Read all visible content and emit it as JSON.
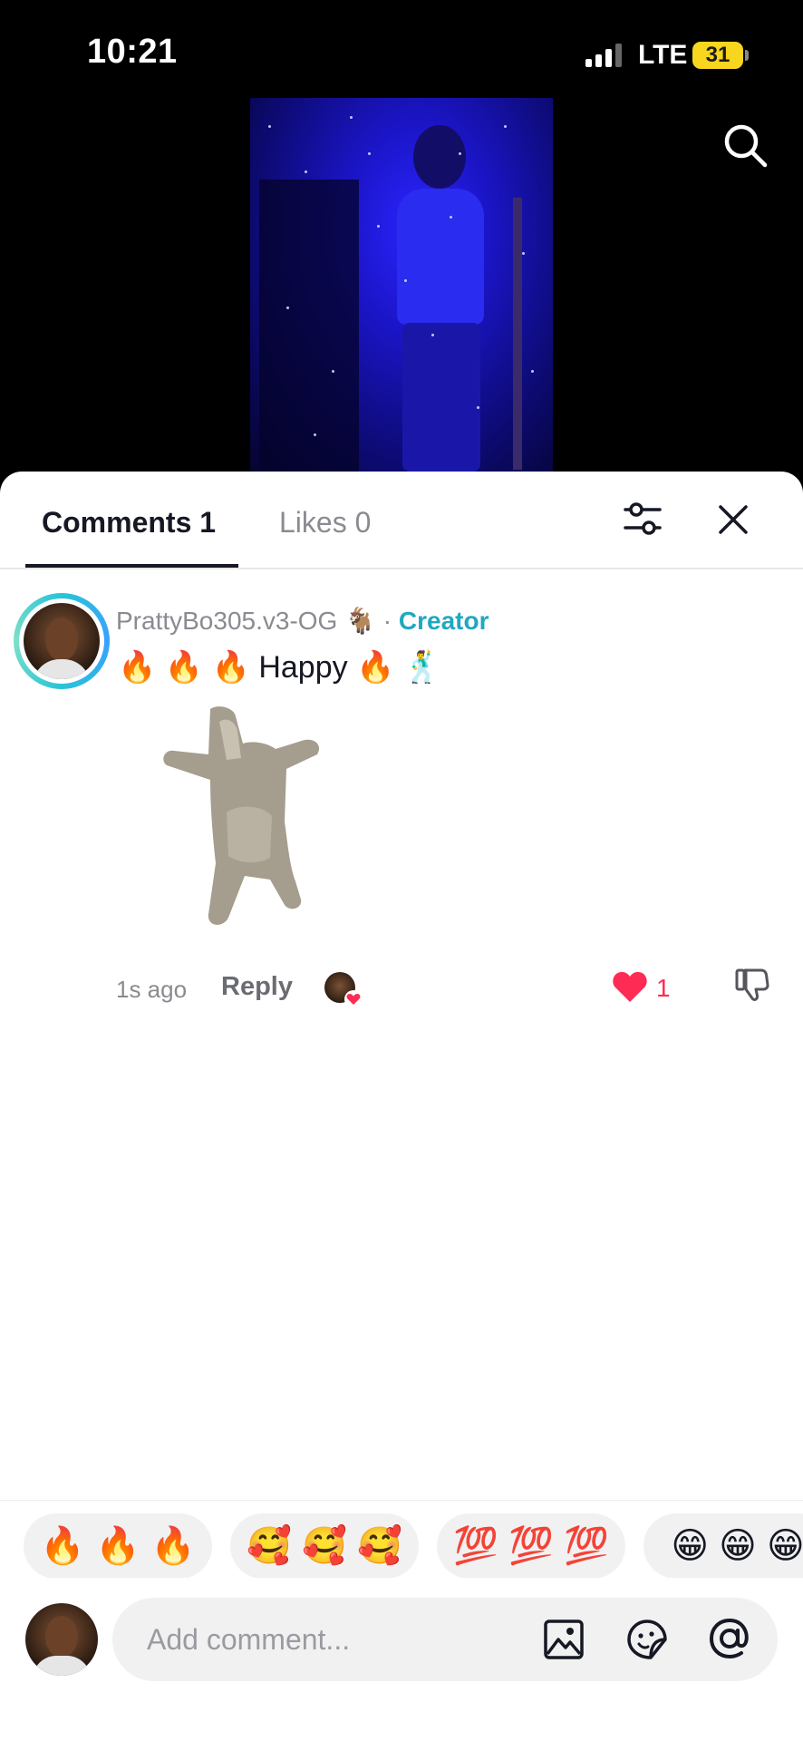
{
  "status_bar": {
    "time": "10:21",
    "network": "LTE",
    "battery": "31"
  },
  "video": {
    "accent_color": "#2a24ff"
  },
  "sheet": {
    "tabs": [
      {
        "label": "Comments 1",
        "active": true
      },
      {
        "label": "Likes 0",
        "active": false
      }
    ]
  },
  "comment": {
    "username": "PrattyBo305.v3-OG 🐐",
    "separator": "·",
    "creator_label": "Creator",
    "text": "🔥 🔥 🔥 Happy 🔥 🕺",
    "time": "1s ago",
    "reply_label": "Reply",
    "like_count": "1",
    "liked": true,
    "liked_by_creator": true
  },
  "emoji_suggestions": [
    "🔥 🔥 🔥",
    "🥰 🥰 🥰",
    "💯 💯 💯",
    "😁 😁 😁"
  ],
  "input": {
    "placeholder": "Add comment..."
  },
  "colors": {
    "creator": "#20a8c0",
    "like": "#fe2c55",
    "text": "#161823",
    "muted": "#8a8b91"
  }
}
